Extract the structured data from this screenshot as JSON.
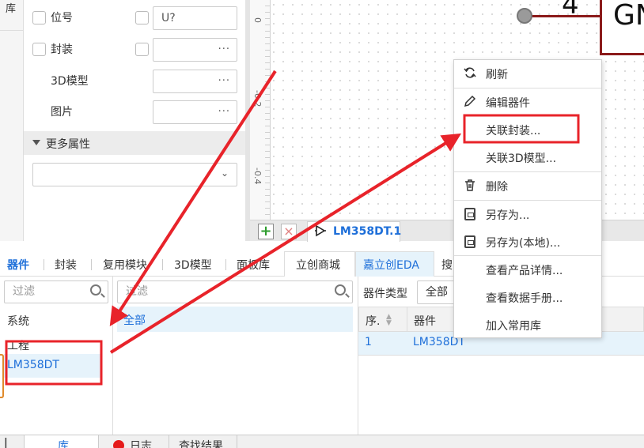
{
  "left_strip": {
    "label": "库"
  },
  "properties": {
    "designator": {
      "label": "位号",
      "value": "U?"
    },
    "footprint": {
      "label": "封装",
      "value": "",
      "more": "···"
    },
    "model3d": {
      "label": "3D模型",
      "value": "",
      "more": "···"
    },
    "image": {
      "label": "图片",
      "value": "",
      "more": "···"
    },
    "more_attrs": "更多属性"
  },
  "canvas": {
    "ruler": [
      "0",
      "-0.2",
      "-0.4"
    ],
    "pin_number": "4",
    "component_text": "GN"
  },
  "canvas_tabs": {
    "add": "+",
    "close": "×",
    "document": "LM358DT.1"
  },
  "lib_tabs": [
    {
      "label": "器件"
    },
    {
      "label": "封装"
    },
    {
      "label": "复用模块"
    },
    {
      "label": "3D模型"
    },
    {
      "label": "面板库"
    },
    {
      "label": "立创商城"
    },
    {
      "label": "嘉立创EDA"
    },
    {
      "label": "搜"
    }
  ],
  "library": {
    "filter_placeholder": "过滤",
    "tree": {
      "system": "系统",
      "project": "工程",
      "lm358": "LM358DT"
    },
    "category_filter_placeholder": "过滤",
    "all": "全部",
    "type_label": "器件类型",
    "type_value": "全部",
    "table": {
      "col_seq": "序.",
      "col_component": "器件",
      "rows": [
        {
          "seq": "1",
          "component": "LM358DT"
        }
      ]
    }
  },
  "bottom_tabs": {
    "first": "|",
    "library": "库",
    "log": "日志",
    "find": "查找结果"
  },
  "context_menu": {
    "refresh": "刷新",
    "edit": "编辑器件",
    "link_footprint": "关联封装...",
    "link_3d": "关联3D模型...",
    "delete": "删除",
    "save_as": "另存为...",
    "save_as_local": "另存为(本地)...",
    "product_details": "查看产品详情...",
    "datasheet": "查看数据手册...",
    "add_common": "加入常用库"
  },
  "colors": {
    "accent_blue": "#1e6fd9",
    "selection_bg": "#e6f3fb",
    "annotation_red": "#e8232a",
    "component_red": "#8b1a1a"
  }
}
